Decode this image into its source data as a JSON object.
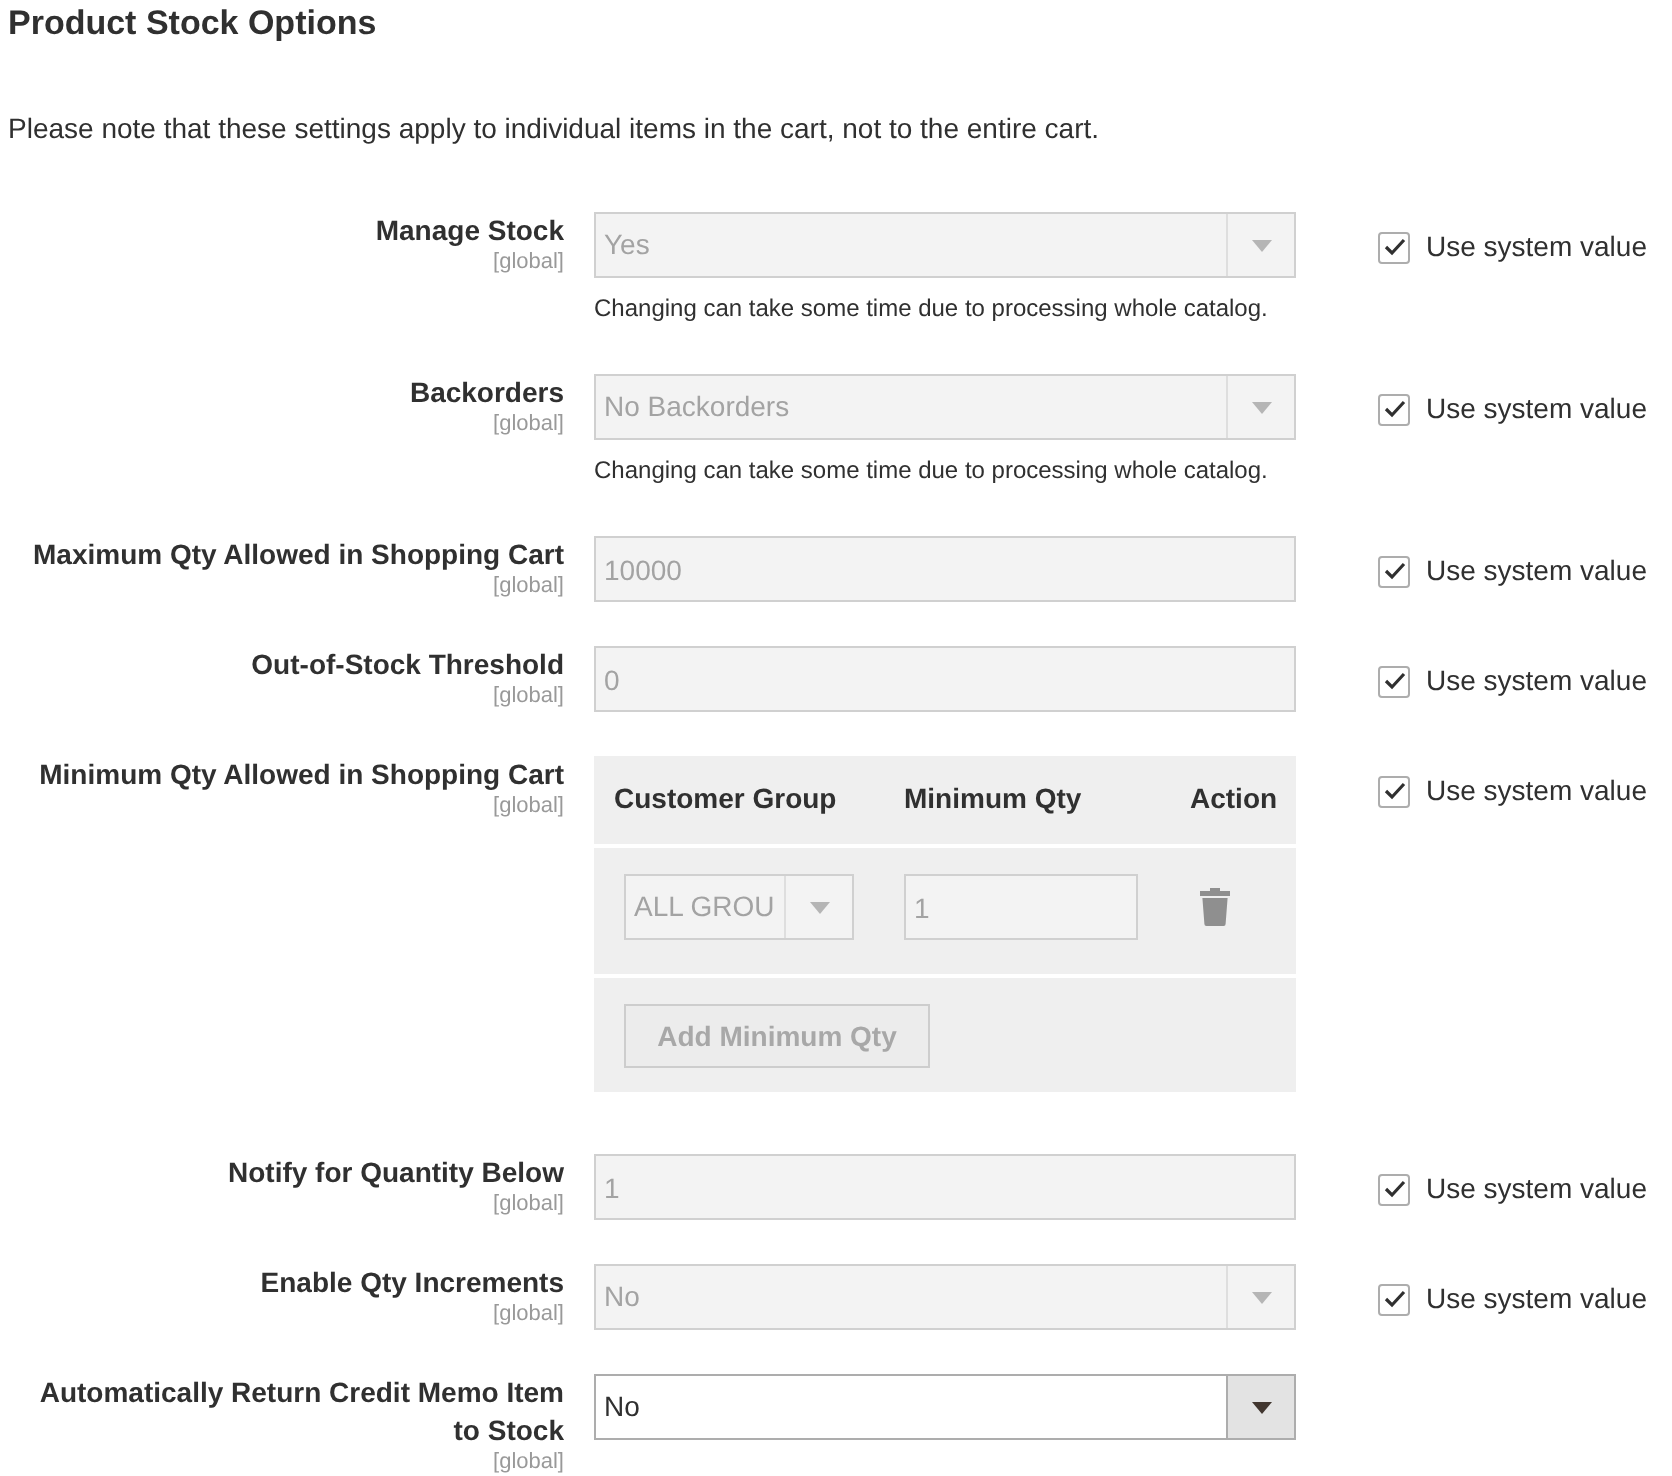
{
  "section": {
    "title": "Product Stock Options",
    "note": "Please note that these settings apply to individual items in the cart, not to the entire cart."
  },
  "fields": [
    {
      "kind": "select",
      "label": "Manage Stock",
      "scope": "[global]",
      "value": "Yes",
      "disabled": true,
      "hint": "Changing can take some time due to processing whole catalog.",
      "use_system_value": {
        "label": "Use system value",
        "checked": true
      }
    },
    {
      "kind": "select",
      "label": "Backorders",
      "scope": "[global]",
      "value": "No Backorders",
      "disabled": true,
      "hint": "Changing can take some time due to processing whole catalog.",
      "use_system_value": {
        "label": "Use system value",
        "checked": true
      }
    },
    {
      "kind": "text",
      "label": "Maximum Qty Allowed in Shopping Cart",
      "scope": "[global]",
      "value": "10000",
      "disabled": true,
      "use_system_value": {
        "label": "Use system value",
        "checked": true
      }
    },
    {
      "kind": "text",
      "label": "Out-of-Stock Threshold",
      "scope": "[global]",
      "value": "0",
      "disabled": true,
      "use_system_value": {
        "label": "Use system value",
        "checked": true
      }
    },
    {
      "kind": "grid",
      "label": "Minimum Qty Allowed in Shopping Cart",
      "scope": "[global]",
      "disabled": true,
      "columns": [
        "Customer Group",
        "Minimum Qty",
        "Action"
      ],
      "rows": [
        {
          "customer_group": "ALL GROU",
          "minimum_qty": "1"
        }
      ],
      "add_button": "Add Minimum Qty",
      "use_system_value": {
        "label": "Use system value",
        "checked": true
      }
    },
    {
      "kind": "text",
      "label": "Notify for Quantity Below",
      "scope": "[global]",
      "value": "1",
      "disabled": true,
      "use_system_value": {
        "label": "Use system value",
        "checked": true
      }
    },
    {
      "kind": "select",
      "label": "Enable Qty Increments",
      "scope": "[global]",
      "value": "No",
      "disabled": true,
      "use_system_value": {
        "label": "Use system value",
        "checked": true
      }
    },
    {
      "kind": "select",
      "label": "Automatically Return Credit Memo Item to Stock",
      "scope": "[global]",
      "value": "No",
      "disabled": false
    }
  ]
}
